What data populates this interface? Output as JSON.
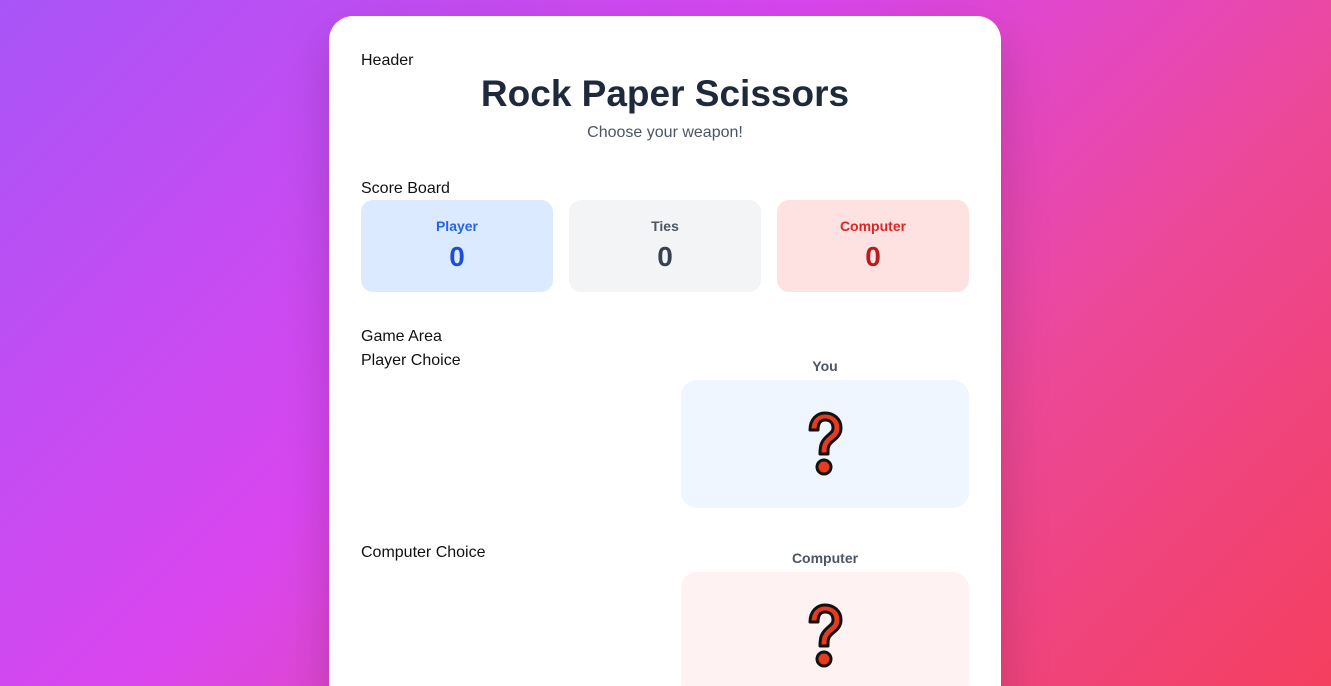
{
  "header": {
    "section_label": "Header",
    "title": "Rock Paper Scissors",
    "subtitle": "Choose your weapon!"
  },
  "scoreboard": {
    "section_label": "Score Board",
    "player": {
      "label": "Player",
      "value": "0"
    },
    "ties": {
      "label": "Ties",
      "value": "0"
    },
    "computer": {
      "label": "Computer",
      "value": "0"
    }
  },
  "game_area": {
    "section_label": "Game Area",
    "player_choice": {
      "section_label": "Player Choice",
      "title": "You",
      "icon": "question-mark-icon"
    },
    "computer_choice": {
      "section_label": "Computer Choice",
      "title": "Computer",
      "icon": "question-mark-icon"
    }
  },
  "colors": {
    "player_accent": "#2563eb",
    "computer_accent": "#dc2626",
    "question_mark": "#e63b1e"
  }
}
